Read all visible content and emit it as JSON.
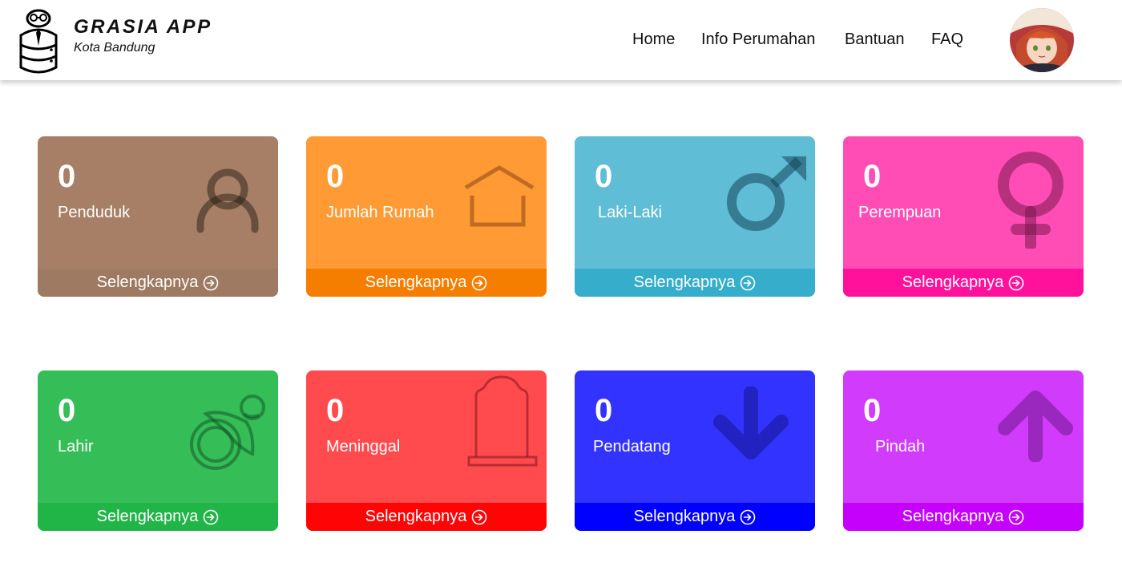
{
  "header": {
    "title": "GRASIA APP",
    "subtitle": "Kota Bandung",
    "logo_icon": "robot-database-icon",
    "avatar_icon": "user-avatar"
  },
  "nav": {
    "items": [
      {
        "label": "Home"
      },
      {
        "label": "Info Perumahan"
      },
      {
        "label": "Bantuan"
      },
      {
        "label": "FAQ"
      }
    ]
  },
  "cards": [
    {
      "count": "0",
      "label": "Penduduk",
      "link": "Selengkapnya",
      "icon": "user-icon",
      "bg": "#a67f66",
      "footer_bg": "#9d7a61"
    },
    {
      "count": "0",
      "label": "Jumlah Rumah",
      "link": "Selengkapnya",
      "icon": "house-icon",
      "bg": "#ff9a34",
      "footer_bg": "#f57e00"
    },
    {
      "count": "0",
      "label": "Laki-Laki",
      "link": "Selengkapnya",
      "icon": "male-icon",
      "bg": "#5fbdd5",
      "footer_bg": "#36aecb"
    },
    {
      "count": "0",
      "label": "Perempuan",
      "link": "Selengkapnya",
      "icon": "female-icon",
      "bg": "#ff4db5",
      "footer_bg": "#ff119b"
    },
    {
      "count": "0",
      "label": "Lahir",
      "link": "Selengkapnya",
      "icon": "pacifier-icon",
      "bg": "#35bd57",
      "footer_bg": "#21b447"
    },
    {
      "count": "0",
      "label": "Meninggal",
      "link": "Selengkapnya",
      "icon": "tombstone-icon",
      "bg": "#ff4b4e",
      "footer_bg": "#ff0404"
    },
    {
      "count": "0",
      "label": "Pendatang",
      "link": "Selengkapnya",
      "icon": "arrow-down-icon",
      "bg": "#3333ff",
      "footer_bg": "#0000ff"
    },
    {
      "count": "0",
      "label": "Pindah",
      "link": "Selengkapnya",
      "icon": "arrow-up-icon",
      "bg": "#d13bfb",
      "footer_bg": "#c601fb"
    }
  ]
}
